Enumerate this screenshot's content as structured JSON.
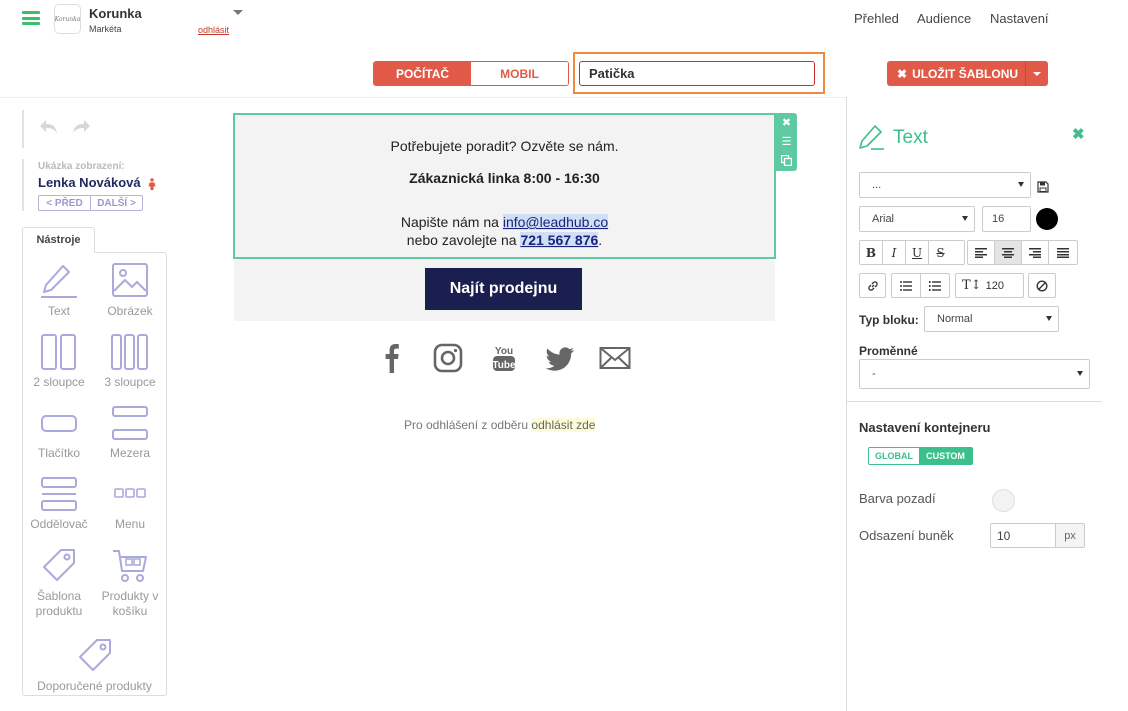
{
  "header": {
    "company": "Korunka",
    "user": "Markéta",
    "logo_text": "Korunka",
    "logout": "odhlásit",
    "nav": [
      "Přehled",
      "Audience",
      "Nastavení"
    ]
  },
  "toolbar": {
    "device_desktop": "POČÍTAČ",
    "device_mobile": "MOBIL",
    "template_name": "Patička",
    "save_label": "ULOŽIT ŠABLONU"
  },
  "preview": {
    "label": "Ukázka zobrazení:",
    "name": "Lenka Nováková",
    "prev": "< PŘED",
    "next": "DALŠÍ >"
  },
  "tools": {
    "tab": "Nástroje",
    "items": {
      "text": "Text",
      "image": "Obrázek",
      "two_columns": "2 sloupce",
      "three_columns": "3 sloupce",
      "button": "Tlačítko",
      "spacer": "Mezera",
      "divider": "Oddělovač",
      "menu": "Menu",
      "product_template_line1": "Šablona",
      "product_template_line2": "produktu",
      "cart_products_line1": "Produkty v",
      "cart_products_line2": "košíku",
      "recommended": "Doporučené produkty"
    }
  },
  "email": {
    "line1": "Potřebujete poradit? Ozvěte se nám.",
    "line2": "Zákaznická linka 8:00 - 16:30",
    "line3_prefix": "Napište nám na ",
    "email_link": "info@leadhub.co",
    "line4_prefix": "nebo zavolejte na ",
    "phone_link": "721 567 876",
    "line4_suffix": ".",
    "button": "Najít prodejnu",
    "social": [
      "facebook",
      "instagram",
      "youtube",
      "twitter",
      "email"
    ],
    "unsubscribe_prefix": "Pro odhlášení z odběru ",
    "unsubscribe_link": "odhlásit zde"
  },
  "properties": {
    "title": "Text",
    "style_select": "...",
    "font": "Arial",
    "size": "16",
    "color": "#000000",
    "line_height": "120",
    "block_type_label": "Typ bloku:",
    "block_type_value": "Normal",
    "variables_label": "Proměnné",
    "variables_value": "-",
    "container_heading": "Nastavení kontejneru",
    "toggle_global": "GLOBAL",
    "toggle_custom": "CUSTOM",
    "bg_label": "Barva pozadí",
    "padding_label": "Odsazení buněk",
    "padding_value": "10",
    "padding_unit": "px"
  },
  "colors": {
    "accent": "#3cbf8a",
    "primary_red": "#e05a47",
    "highlight_orange": "#f08a3c",
    "navy": "#1b1f4f"
  }
}
